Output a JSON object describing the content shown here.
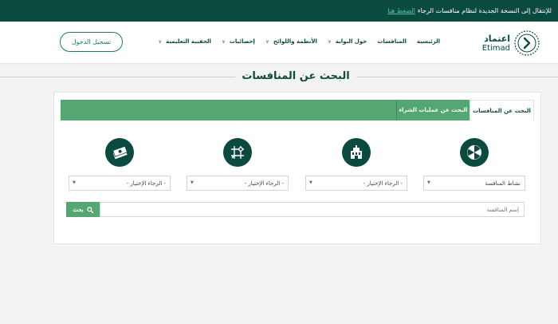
{
  "announcement": {
    "text": "للإنتقال إلى النسخة الجديدة لنظام منافسات الرجاء",
    "link": "الضغط هنا"
  },
  "header": {
    "login_label": "تسجيل الدخول",
    "nav": [
      {
        "label": "الرئيسية",
        "has_menu": false
      },
      {
        "label": "المنافسات",
        "has_menu": false
      },
      {
        "label": "حول البوابة",
        "has_menu": true
      },
      {
        "label": "الأنظمة واللوائح",
        "has_menu": true
      },
      {
        "label": "إحصائيات",
        "has_menu": true
      },
      {
        "label": "الحقيبة التعليمية",
        "has_menu": true
      }
    ],
    "logo": {
      "arabic": "اعتماد",
      "english": "Etimad"
    }
  },
  "page_title": "البحث عن المنافسات",
  "tabs": {
    "active": "البحث عن المنافسات",
    "other": "البحث عن عمليات الشراء"
  },
  "filters": [
    {
      "icon": "competition-activity-icon",
      "value": "نشاط المنافسة"
    },
    {
      "icon": "building-icon",
      "value": "- الرجاء الإختيار -"
    },
    {
      "icon": "map-icon",
      "value": "- الرجاء الإختيار -"
    },
    {
      "icon": "money-icon",
      "value": "- الرجاء الإختيار -"
    }
  ],
  "search": {
    "placeholder": "إسم المنافسة",
    "button_label": "بحث"
  },
  "colors": {
    "dark_green": "#0b4a3e",
    "tab_green": "#55a772",
    "link_green": "#59c39a"
  }
}
